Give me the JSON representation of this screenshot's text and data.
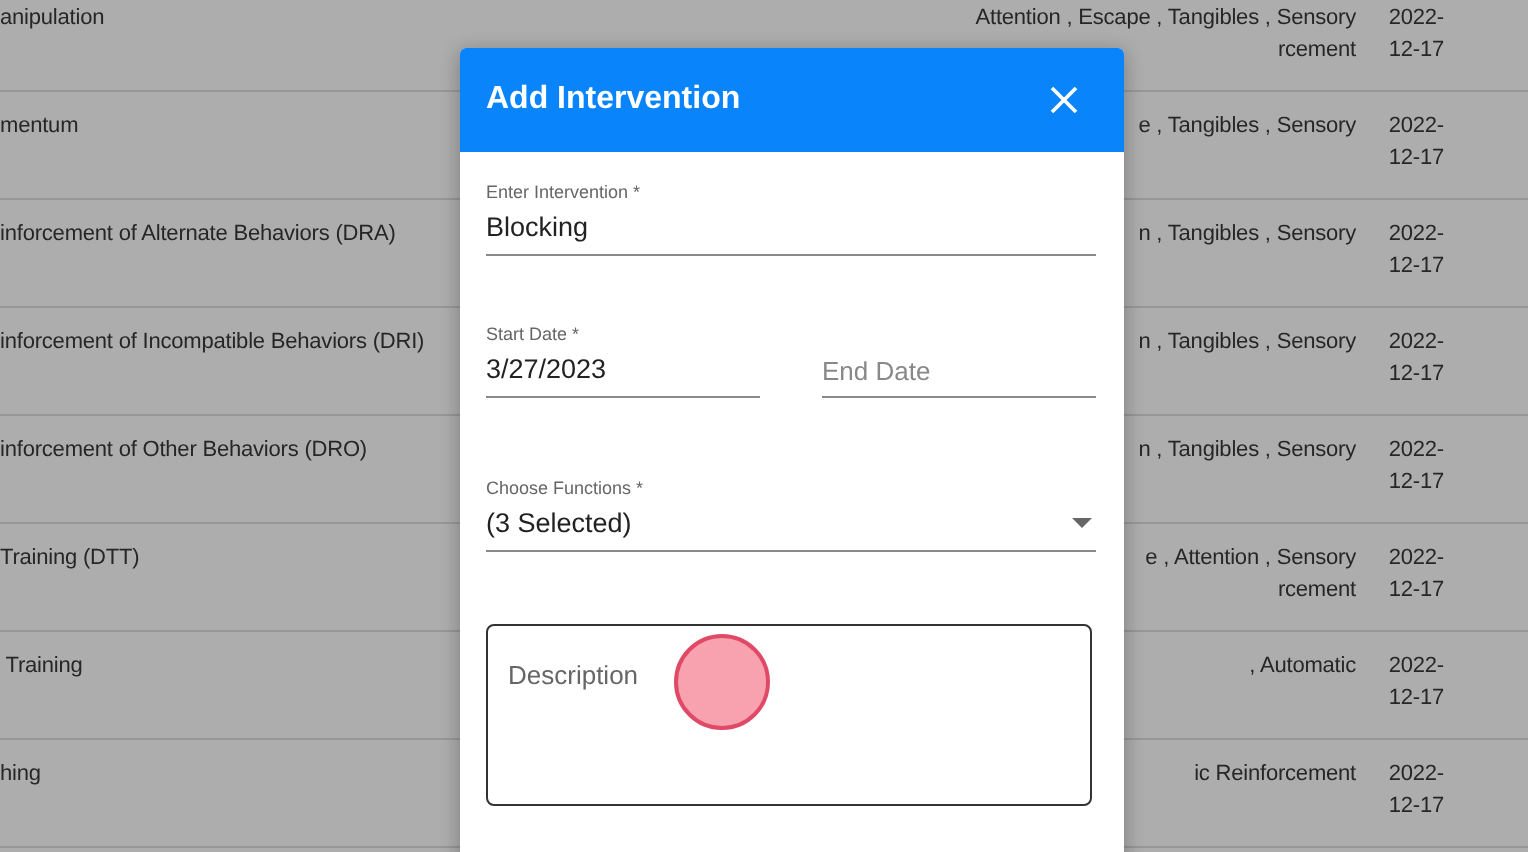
{
  "background_table": {
    "rows": [
      {
        "intervention": "anipulation",
        "functions": [
          "Attention , Escape , Tangibles , Sensory",
          "rcement"
        ],
        "date": [
          "2022-",
          "12-17"
        ]
      },
      {
        "intervention": "mentum",
        "functions": [
          "e , Tangibles , Sensory"
        ],
        "date": [
          "2022-",
          "12-17"
        ]
      },
      {
        "intervention": "inforcement of Alternate Behaviors (DRA)",
        "functions": [
          "n , Tangibles , Sensory"
        ],
        "date": [
          "2022-",
          "12-17"
        ]
      },
      {
        "intervention": "inforcement of Incompatible Behaviors (DRI)",
        "functions": [
          "n , Tangibles , Sensory"
        ],
        "date": [
          "2022-",
          "12-17"
        ]
      },
      {
        "intervention": "inforcement of Other Behaviors (DRO)",
        "functions": [
          "n , Tangibles , Sensory"
        ],
        "date": [
          "2022-",
          "12-17"
        ]
      },
      {
        "intervention": "Training (DTT)",
        "functions": [
          "e , Attention , Sensory",
          "rcement"
        ],
        "date": [
          "2022-",
          "12-17"
        ]
      },
      {
        "intervention": " Training",
        "functions": [
          ", Automatic"
        ],
        "date": [
          "2022-",
          "12-17"
        ]
      },
      {
        "intervention": "hing",
        "functions": [
          "ic Reinforcement"
        ],
        "date": [
          "2022-",
          "12-17"
        ]
      }
    ]
  },
  "dialog": {
    "title": "Add Intervention",
    "intervention": {
      "label": "Enter Intervention *",
      "value": "Blocking"
    },
    "start_date": {
      "label": "Start Date *",
      "value": "3/27/2023"
    },
    "end_date": {
      "placeholder": "End Date"
    },
    "functions": {
      "label": "Choose Functions *",
      "value": "(3 Selected)"
    },
    "description": {
      "placeholder": "Description"
    }
  }
}
